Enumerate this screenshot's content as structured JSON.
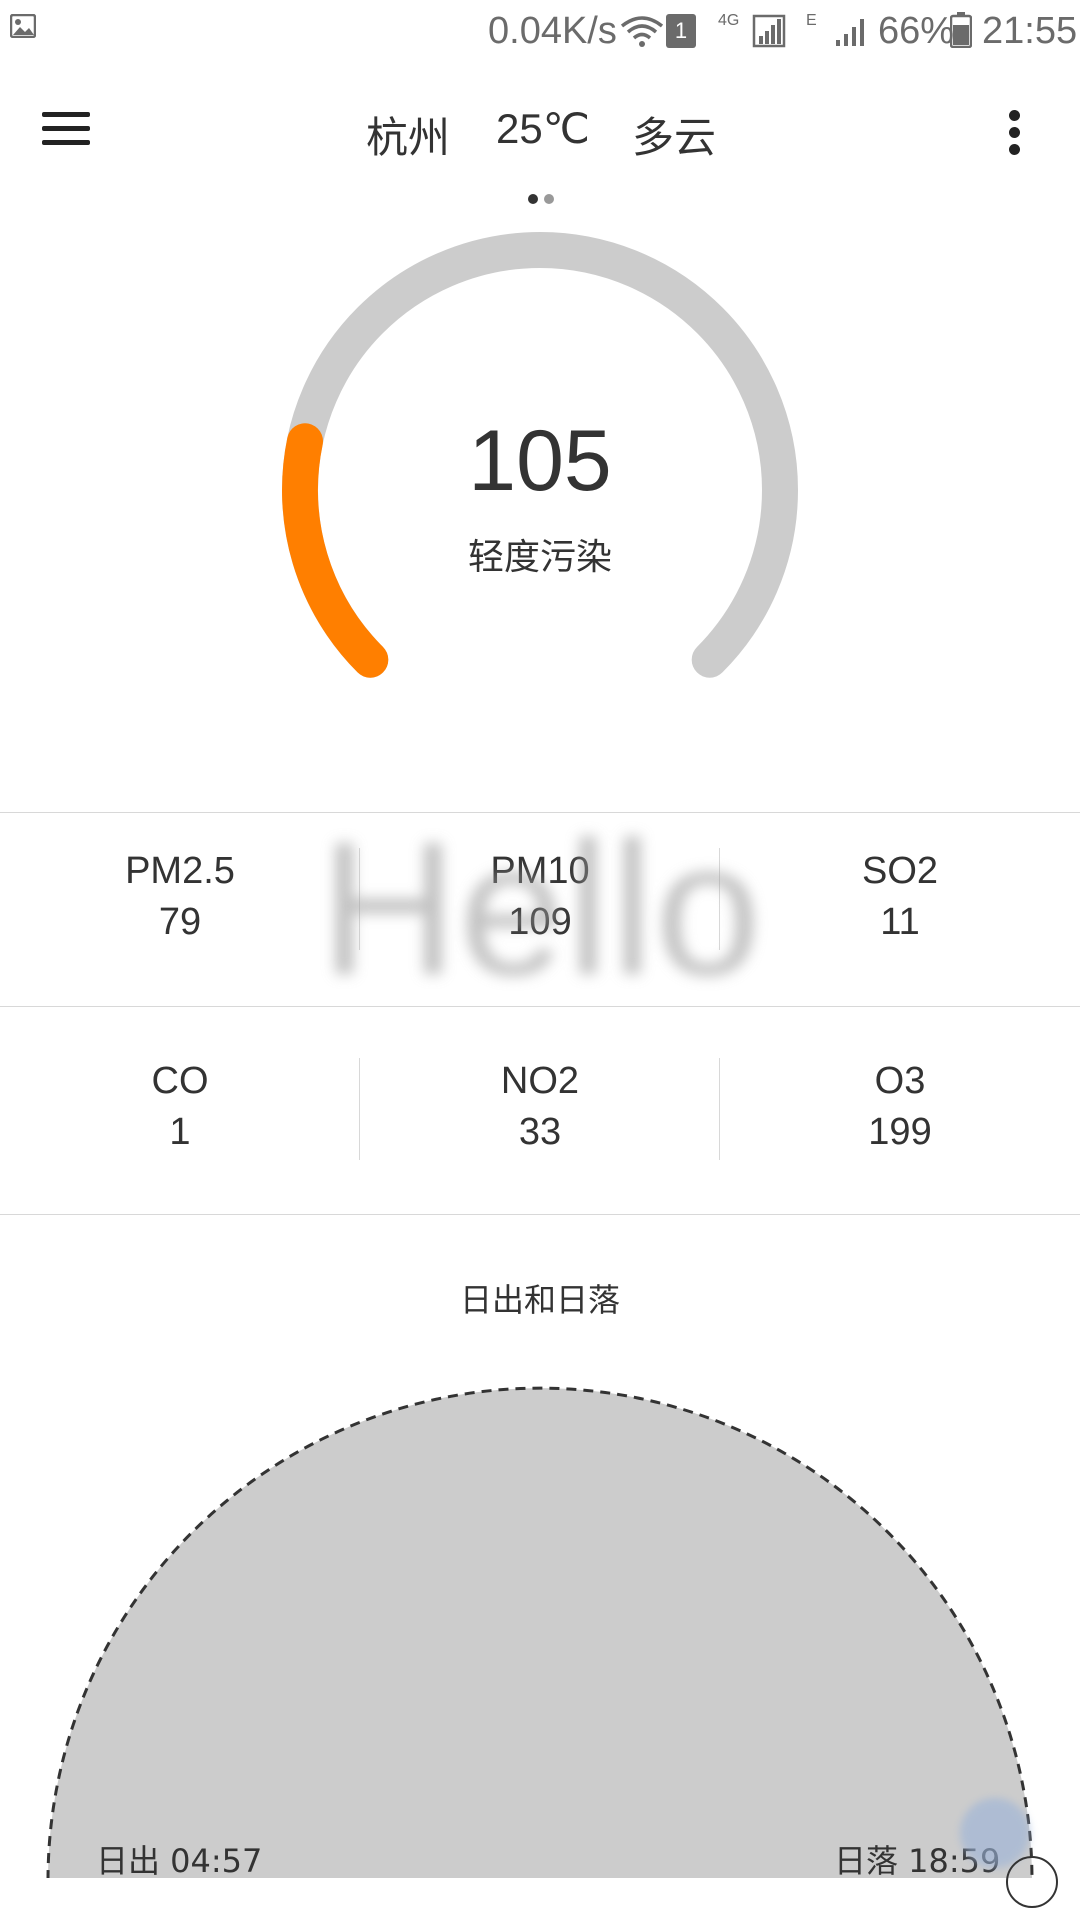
{
  "status_bar": {
    "net_speed": "0.04K/s",
    "sim_badge": "1",
    "network_4g": "4G",
    "network_e": "E",
    "battery": "66%",
    "time": "21:55"
  },
  "header": {
    "city": "杭州",
    "temperature": "25℃",
    "weather": "多云"
  },
  "aqi": {
    "value": "105",
    "level": "轻度污染",
    "progress": 0.21,
    "accent_color": "#ff7f00",
    "track_color": "#cccccc"
  },
  "pollutants": [
    {
      "name": "PM2.5",
      "value": "79"
    },
    {
      "name": "PM10",
      "value": "109"
    },
    {
      "name": "SO2",
      "value": "11"
    },
    {
      "name": "CO",
      "value": "1"
    },
    {
      "name": "NO2",
      "value": "33"
    },
    {
      "name": "O3",
      "value": "199"
    }
  ],
  "watermark": "Hello",
  "sun": {
    "title": "日出和日落",
    "sunrise_label": "日出 04:57",
    "sunset_label": "日落 18:59"
  },
  "icons": {
    "gallery": "image-icon",
    "wifi": "wifi-icon",
    "signal": "signal-icon",
    "battery": "battery-icon",
    "menu": "hamburger-menu-icon",
    "more": "more-vertical-icon"
  }
}
